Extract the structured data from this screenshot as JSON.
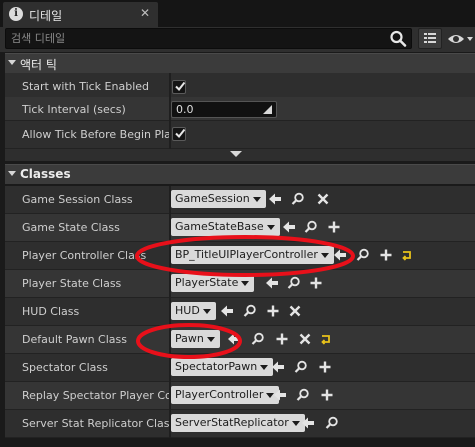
{
  "tab": {
    "title": "디테일",
    "icon": "info-icon",
    "close": "✕"
  },
  "search": {
    "placeholder": "검색 디테일"
  },
  "sections": {
    "actor_tick": {
      "title": "액터 틱"
    },
    "classes": {
      "title": "Classes"
    }
  },
  "tick": {
    "start_enabled_label": "Start with Tick Enabled",
    "start_enabled_checked": true,
    "interval_label": "Tick Interval (secs)",
    "interval_value": "0.0",
    "allow_before_label": "Allow Tick Before Begin Play",
    "allow_before_checked": true
  },
  "classes": {
    "game_session": {
      "label": "Game Session Class",
      "value": "GameSession"
    },
    "game_state": {
      "label": "Game State Class",
      "value": "GameStateBase"
    },
    "player_controller": {
      "label": "Player Controller Class",
      "value": "BP_TitleUIPlayerController"
    },
    "player_state": {
      "label": "Player State Class",
      "value": "PlayerState"
    },
    "hud": {
      "label": "HUD Class",
      "value": "HUD"
    },
    "default_pawn": {
      "label": "Default Pawn Class",
      "value": "Pawn"
    },
    "spectator": {
      "label": "Spectator Class",
      "value": "SpectatorPawn"
    },
    "replay_spectator": {
      "label": "Replay Spectator Player Controller Class",
      "value": "PlayerController"
    },
    "server_stat": {
      "label": "Server Stat Replicator Class",
      "value": "ServerStatReplicator"
    }
  },
  "colors": {
    "highlight_ellipse": "#e8101a",
    "reset_arrow": "#e8c21a",
    "panel_bg": "#2e2e2e",
    "combo_bg": "#dadada"
  }
}
